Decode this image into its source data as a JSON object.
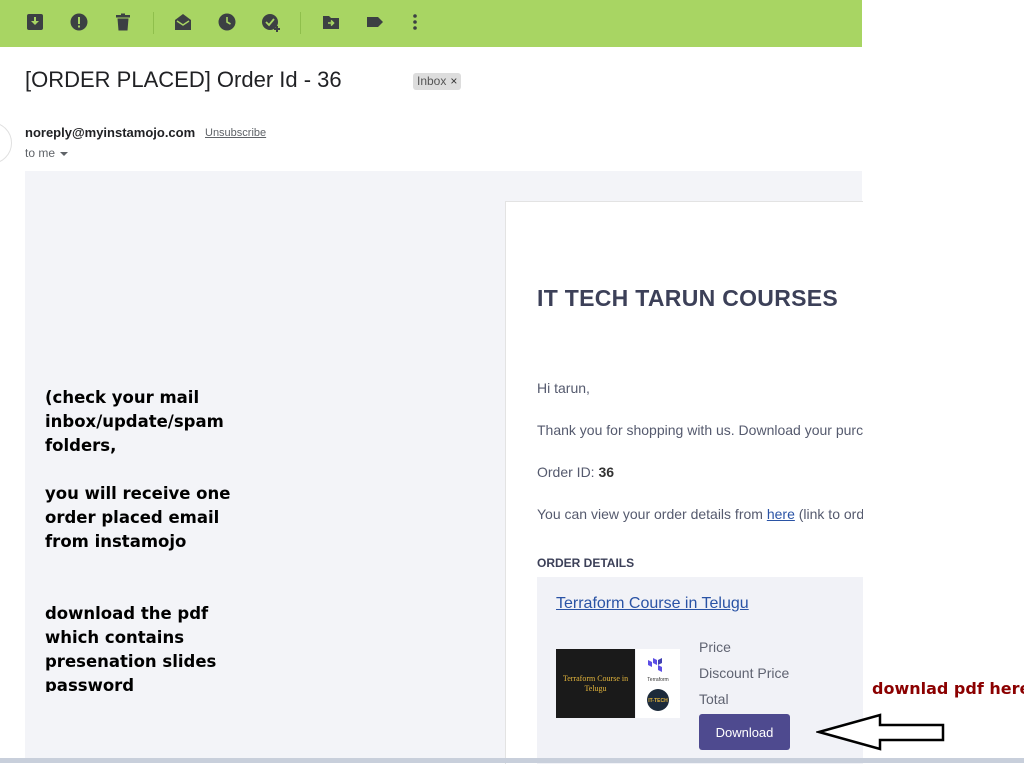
{
  "toolbar": {
    "icons": [
      "archive-icon",
      "report-spam-icon",
      "delete-icon",
      "mark-unread-icon",
      "snooze-icon",
      "add-task-icon",
      "move-to-icon",
      "label-icon",
      "more-icon"
    ]
  },
  "email": {
    "subject": "[ORDER PLACED] Order Id - 36",
    "label": "Inbox",
    "label_close": "×",
    "sender": "noreply@myinstamojo.com",
    "unsubscribe": "Unsubscribe",
    "to": "to me"
  },
  "card": {
    "brand": "IT TECH TARUN COURSES",
    "greeting": "Hi tarun,",
    "thanks": "Thank you for shopping with us. Download your purc",
    "order_id_label": "Order ID: ",
    "order_id": "36",
    "view_prefix": "You can view your order details from ",
    "view_link": "here",
    "view_suffix": " (link to ord",
    "order_details": "ORDER DETAILS",
    "course_title": "Terraform Course in Telugu",
    "thumb_text": "Terraform Course in Telugu",
    "price_label": "Price",
    "discount_label": "Discount Price",
    "total_label": "Total",
    "download": "Download"
  },
  "notes": {
    "block1": [
      "(check your mail",
      "inbox/update/spam",
      "folders,"
    ],
    "block2": [
      "you will receive one",
      "order placed email",
      "from instamojo"
    ],
    "block3": [
      "download the pdf",
      "which contains",
      "presenation slides",
      "password"
    ]
  },
  "annotation": "downlad pdf here",
  "colors": {
    "toolbar": "#a8d563",
    "button": "#4e4a8f",
    "annotation": "#8b0000",
    "link": "#2a53a5"
  }
}
